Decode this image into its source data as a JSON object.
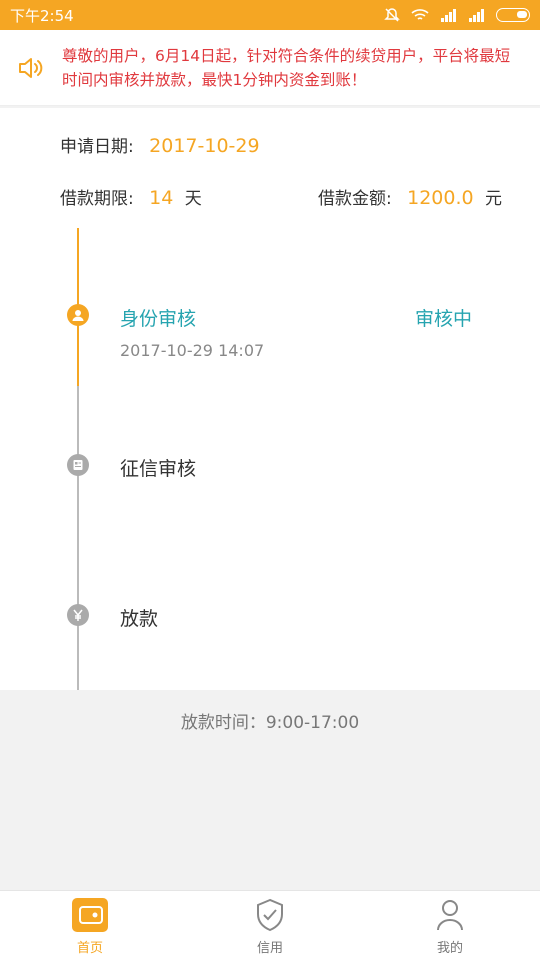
{
  "status_bar": {
    "time": "下午2:54"
  },
  "notice": {
    "text": "尊敬的用户，6月14日起，针对符合条件的续贷用户，平台将最短时间内审核并放款，最快1分钟内资金到账！"
  },
  "loan": {
    "apply_date_label": "申请日期:",
    "apply_date": "2017-10-29",
    "term_label": "借款期限:",
    "term_value": "14",
    "term_unit": "天",
    "amount_label": "借款金额:",
    "amount_value": "1200.0",
    "amount_unit": "元"
  },
  "steps": [
    {
      "label": "身份审核",
      "status": "审核中",
      "time": "2017-10-29 14:07"
    },
    {
      "label": "征信审核"
    },
    {
      "label": "放款"
    }
  ],
  "footer": {
    "note": "放款时间：9:00-17:00"
  },
  "nav": [
    {
      "label": "首页"
    },
    {
      "label": "信用"
    },
    {
      "label": "我的"
    }
  ],
  "colors": {
    "accent": "#f5a623",
    "teal": "#26a4b0",
    "notice_red": "#e0393e"
  }
}
